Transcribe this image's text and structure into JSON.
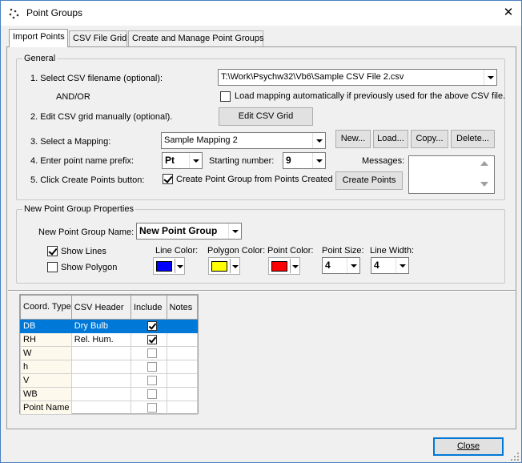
{
  "window": {
    "title": "Point Groups",
    "close_glyph": "✕",
    "icon": "app-dots-icon"
  },
  "tabs": [
    {
      "label": "Import Points",
      "active": true
    },
    {
      "label": "CSV File Grid",
      "active": false
    },
    {
      "label": "Create and Manage Point Groups",
      "active": false
    }
  ],
  "general": {
    "label": "General",
    "step1_label": "1.  Select CSV filename (optional):",
    "csv_filename": "T:\\Work\\Psychw32\\Vb6\\Sample CSV File 2.csv",
    "and_or": "AND/OR",
    "load_mapping_label": "Load mapping automatically if previously used for the above CSV file.",
    "load_mapping_checked": false,
    "step2_label": "2.  Edit CSV grid manually (optional).",
    "edit_grid_button": "Edit CSV Grid",
    "step3_label": "3.  Select a Mapping:",
    "mapping_value": "Sample Mapping 2",
    "new_button": "New...",
    "load_button": "Load...",
    "copy_button": "Copy...",
    "delete_button": "Delete...",
    "step4_label": "4.  Enter point name prefix:",
    "prefix_value": "Pt",
    "starting_number_label": "Starting number:",
    "starting_number_value": "9",
    "messages_label": "Messages:",
    "step5_label": "5.  Click Create Points button:",
    "create_group_label": "Create Point Group from Points Created",
    "create_group_checked": true,
    "create_points_button": "Create Points"
  },
  "properties": {
    "label": "New Point Group Properties",
    "name_label": "New Point Group Name:",
    "name_value": "New Point Group",
    "show_lines_label": "Show Lines",
    "show_lines_checked": true,
    "show_polygon_label": "Show Polygon",
    "show_polygon_checked": false,
    "line_color_label": "Line Color:",
    "line_color": "#0000ff",
    "polygon_color_label": "Polygon Color:",
    "polygon_color": "#ffff00",
    "point_color_label": "Point Color:",
    "point_color": "#ff0000",
    "point_size_label": "Point Size:",
    "point_size_value": "4",
    "line_width_label": "Line Width:",
    "line_width_value": "4"
  },
  "grid": {
    "headers": [
      "Coord. Type",
      "CSV Header",
      "Include",
      "Notes"
    ],
    "rows": [
      {
        "type": "DB",
        "csv_header": "Dry Bulb",
        "include": true,
        "notes": "",
        "selected": true
      },
      {
        "type": "RH",
        "csv_header": "Rel. Hum.",
        "include": true,
        "notes": "",
        "selected": false
      },
      {
        "type": "W",
        "csv_header": "",
        "include": false,
        "notes": "",
        "selected": false
      },
      {
        "type": "h",
        "csv_header": "",
        "include": false,
        "notes": "",
        "selected": false
      },
      {
        "type": "V",
        "csv_header": "",
        "include": false,
        "notes": "",
        "selected": false
      },
      {
        "type": "WB",
        "csv_header": "",
        "include": false,
        "notes": "",
        "selected": false
      },
      {
        "type": "Point Name",
        "csv_header": "",
        "include": false,
        "notes": "",
        "selected": false
      }
    ]
  },
  "footer": {
    "close_button": "Close"
  }
}
